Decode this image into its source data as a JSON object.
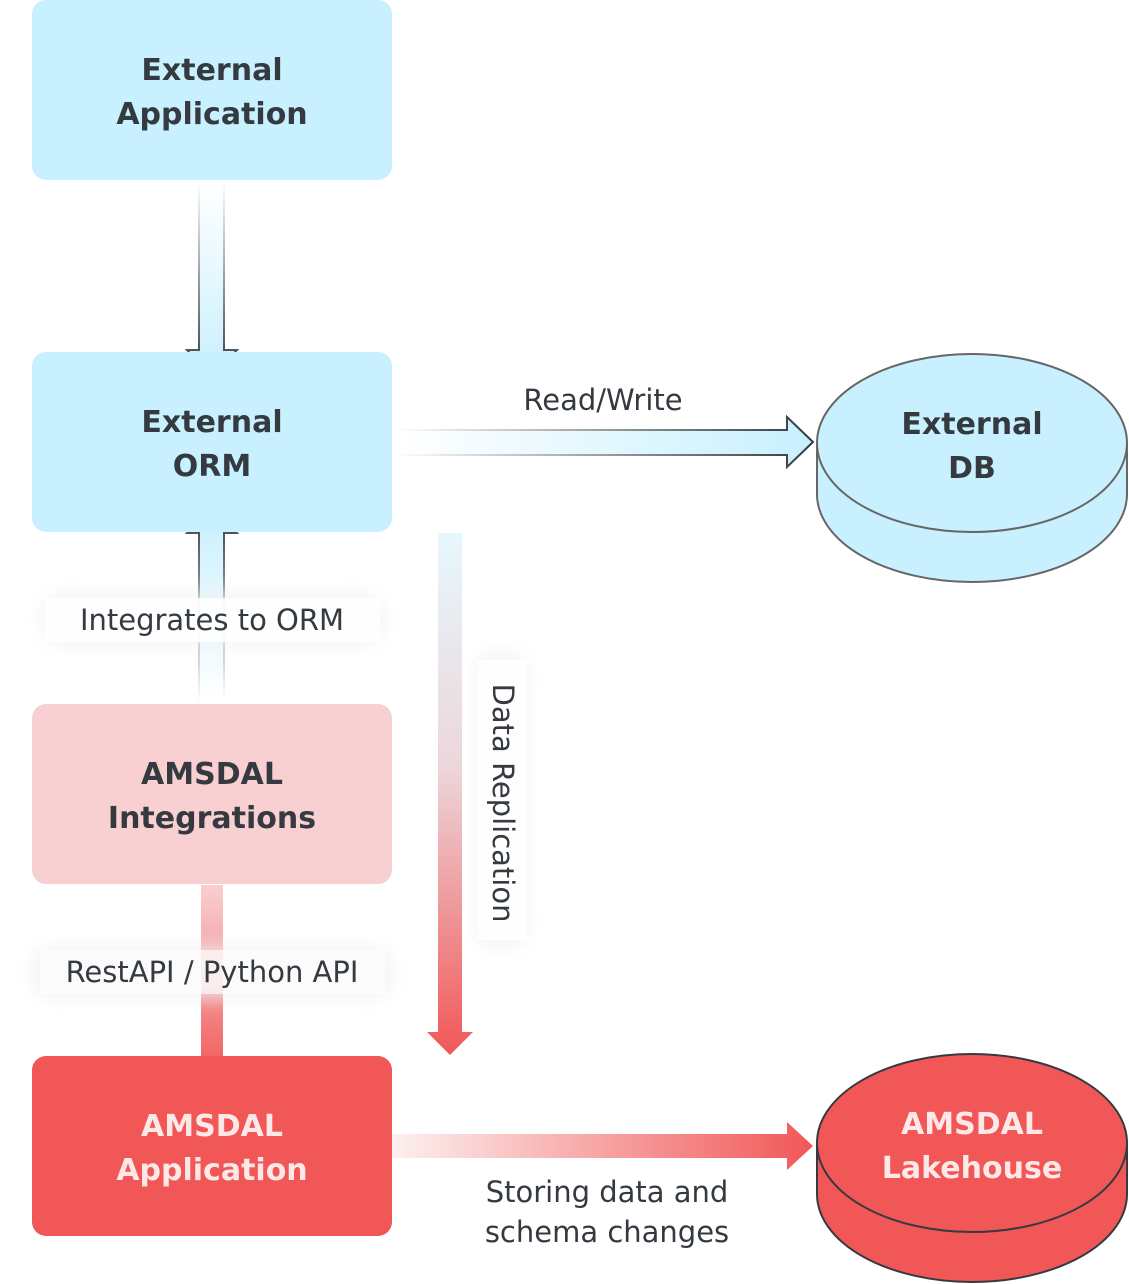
{
  "colors": {
    "light_blue": "#C8F0FE",
    "light_pink": "#F8D0D2",
    "red": "#F15757",
    "text": "#343A40"
  },
  "nodes": {
    "external_application": {
      "line1": "External",
      "line2": "Application"
    },
    "external_orm": {
      "line1": "External",
      "line2": "ORM"
    },
    "external_db": {
      "line1": "External",
      "line2": "DB"
    },
    "amsdal_integrations": {
      "line1": "AMSDAL",
      "line2": "Integrations"
    },
    "amsdal_application": {
      "line1": "AMSDAL",
      "line2": "Application"
    },
    "amsdal_lakehouse": {
      "line1": "AMSDAL",
      "line2": "Lakehouse"
    }
  },
  "edges": {
    "read_write": "Read/Write",
    "integrates_to_orm": "Integrates to ORM",
    "data_replication": "Data Replication",
    "rest_python_api": "RestAPI / Python API",
    "storing_line1": "Storing data and",
    "storing_line2": "schema changes"
  }
}
